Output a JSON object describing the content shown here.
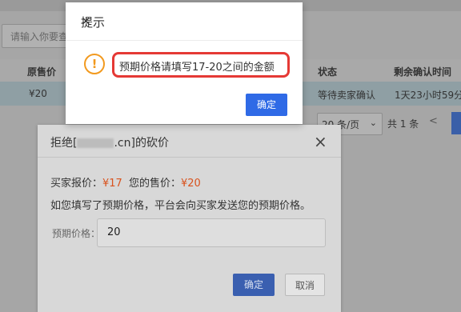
{
  "background": {
    "search_placeholder": "请输入你要查",
    "columns": {
      "original_price": "原售价",
      "status": "状态",
      "remaining_time": "剩余确认时间"
    },
    "row": {
      "price": "¥20",
      "status": "等待卖家确认",
      "remaining": "1天23小时59分"
    },
    "pager": {
      "page_size": "20 条/页",
      "total": "共 1 条",
      "prev": "<"
    }
  },
  "reject_dialog": {
    "title_prefix": "拒绝[",
    "title_suffix": ".cn]的砍价",
    "buyer_offer_label": "买家报价：",
    "buyer_offer_value": "¥17",
    "your_price_label": "您的售价：",
    "your_price_value": "¥20",
    "notice": "如您填写了预期价格，平台会向买家发送您的预期价格。",
    "expected_price_label": "预期价格：",
    "expected_price_value": "20",
    "confirm": "确定",
    "cancel": "取消",
    "close": "×"
  },
  "prompt_dialog": {
    "title": "提示",
    "close": "×",
    "icon": "!",
    "message": "预期价格请填写17-20之间的金额",
    "confirm": "确定"
  },
  "colors": {
    "accent_blue": "#2f6ae6",
    "warning_orange": "#f29a1f",
    "highlight_red": "#e53935",
    "price_red": "#d9531e"
  }
}
